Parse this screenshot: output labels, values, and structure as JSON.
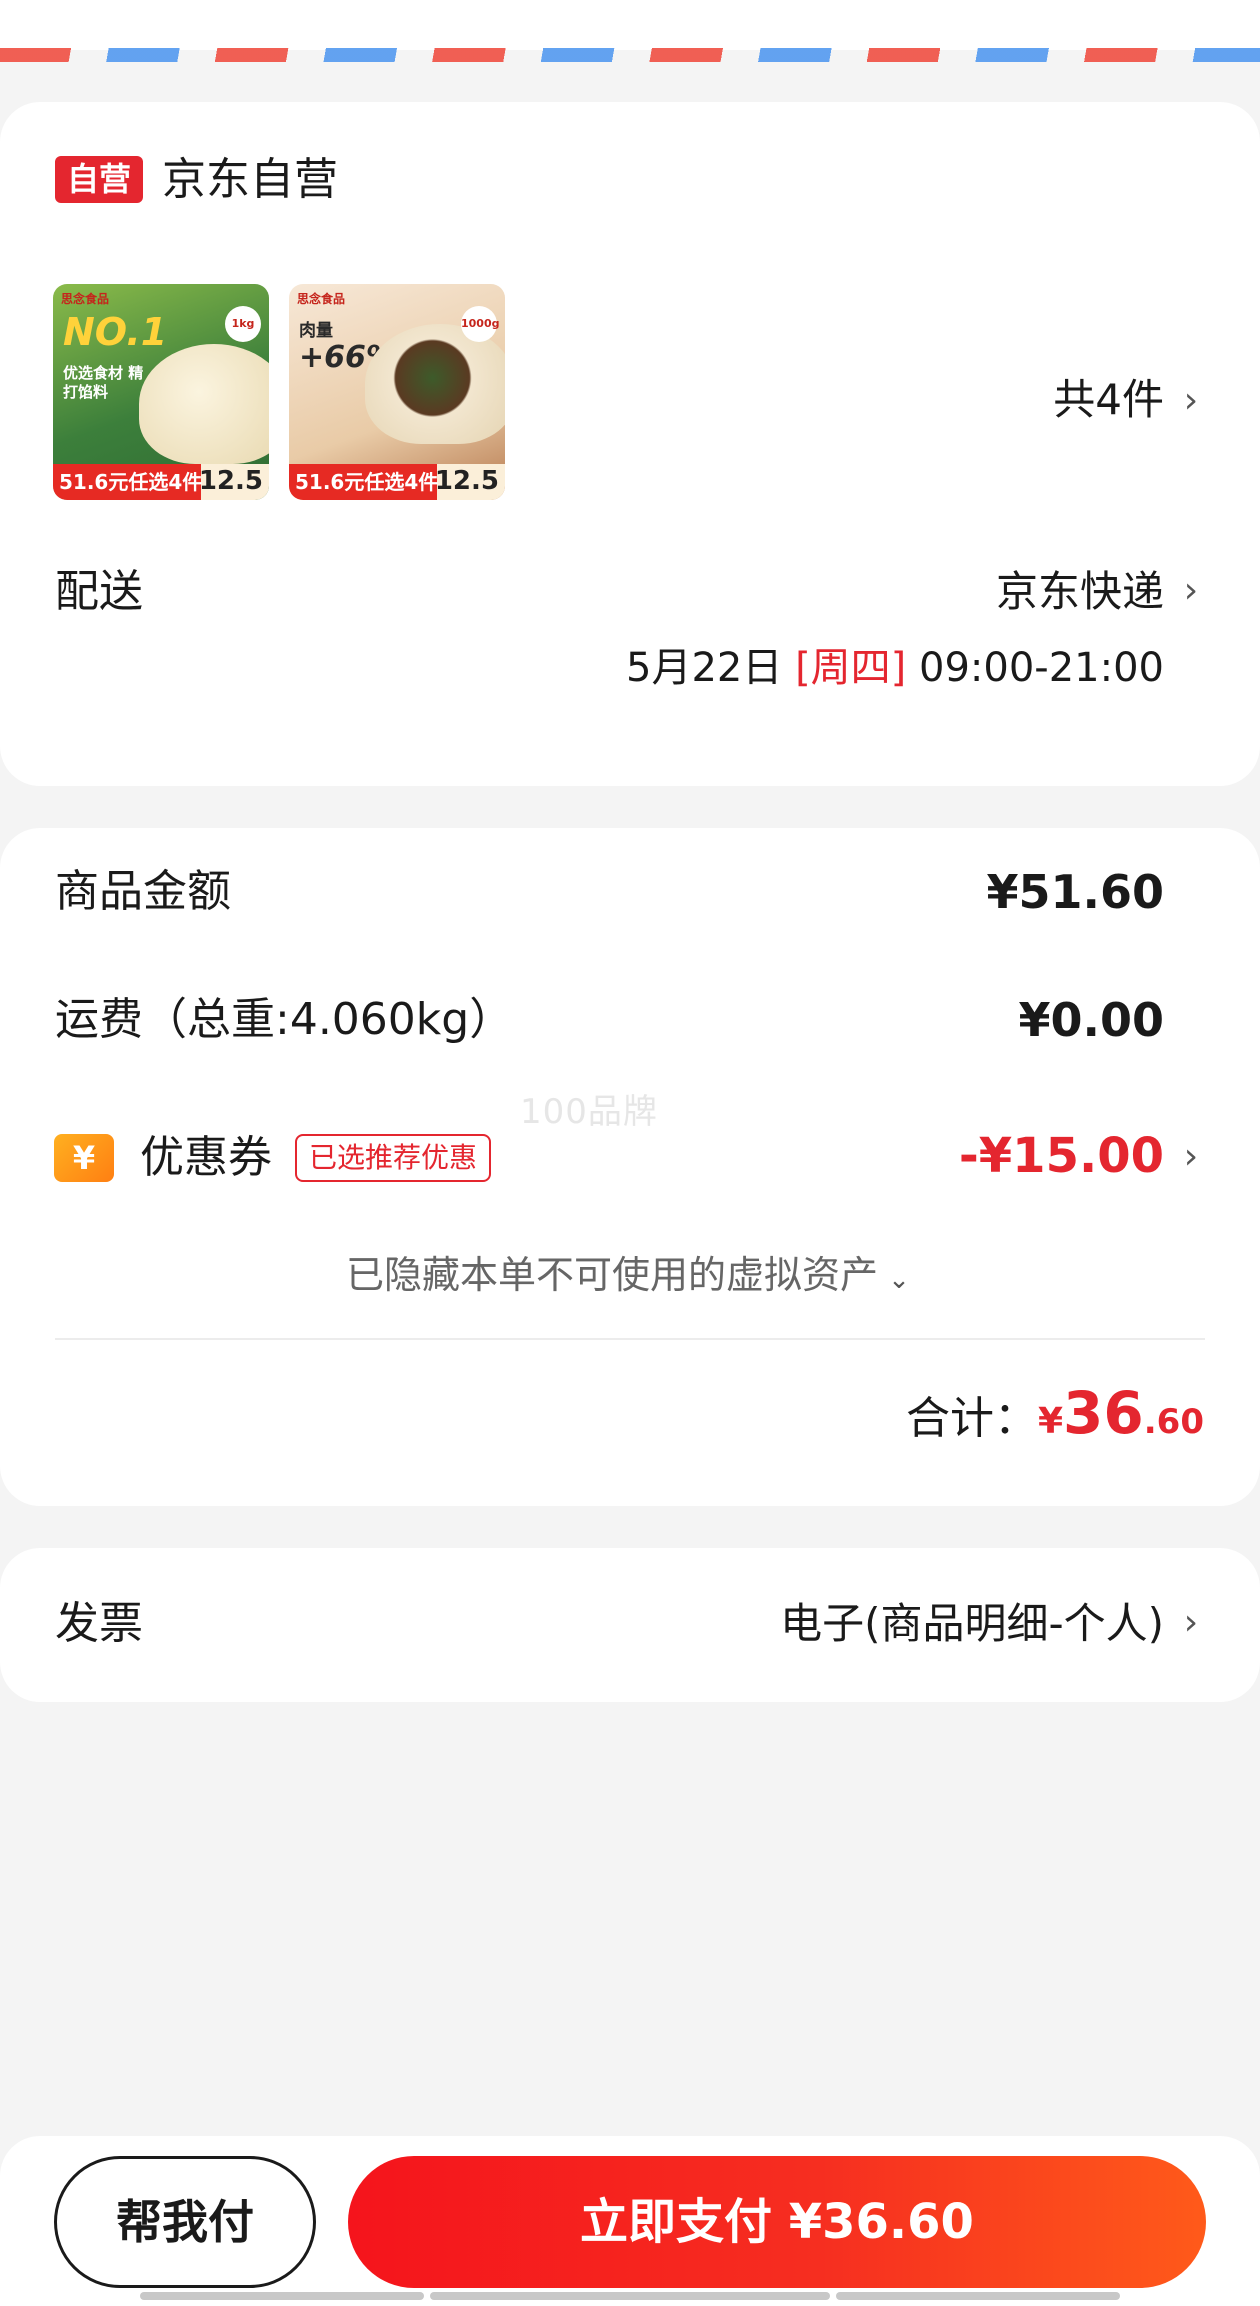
{
  "store": {
    "badge": "自营",
    "name": "京东自营"
  },
  "products": [
    {
      "brand": "思念食品",
      "headline": "NO.1",
      "tagline": "优选食材 精打馅料",
      "weight_badge": "1kg",
      "promo": "51.6元任选4件",
      "price": "12.5"
    },
    {
      "brand": "思念食品",
      "headline": "+66%",
      "tagline": "肉量",
      "weight_badge": "1000g",
      "promo": "51.6元任选4件",
      "price": "12.5"
    }
  ],
  "quantity_text": "共4件",
  "delivery": {
    "label": "配送",
    "method": "京东快递",
    "date": "5月22日",
    "weekday": "[周四]",
    "time": "09:00-21:00"
  },
  "amounts": {
    "goods_label": "商品金额",
    "goods_value": "¥51.60",
    "shipping_label": "运费（总重:4.060kg）",
    "shipping_value": "¥0.00",
    "coupon_icon_glyph": "¥",
    "coupon_label": "优惠券",
    "coupon_tag": "已选推荐优惠",
    "coupon_value": "-¥15.00",
    "hidden_assets_text": "已隐藏本单不可使用的虚拟资产",
    "total_label": "合计：",
    "total_currency": "¥",
    "total_integer": "36",
    "total_decimal": ".60"
  },
  "watermark": "100品牌",
  "invoice": {
    "label": "发票",
    "value": "电子(商品明细-个人)"
  },
  "footer": {
    "help_pay_label": "帮我付",
    "pay_now_label": "立即支付 ¥36.60"
  },
  "colors": {
    "accent_red": "#e4262f",
    "pay_gradient_start": "#f5141c",
    "pay_gradient_end": "#ff5a1a",
    "coupon_orange": "#ff9a18",
    "airmail_red": "#f0574b",
    "airmail_blue": "#5b9ef0"
  },
  "icons": {
    "chevron": "chevron-right-icon",
    "expand": "chevron-down-icon",
    "coupon": "coupon-yen-icon"
  }
}
